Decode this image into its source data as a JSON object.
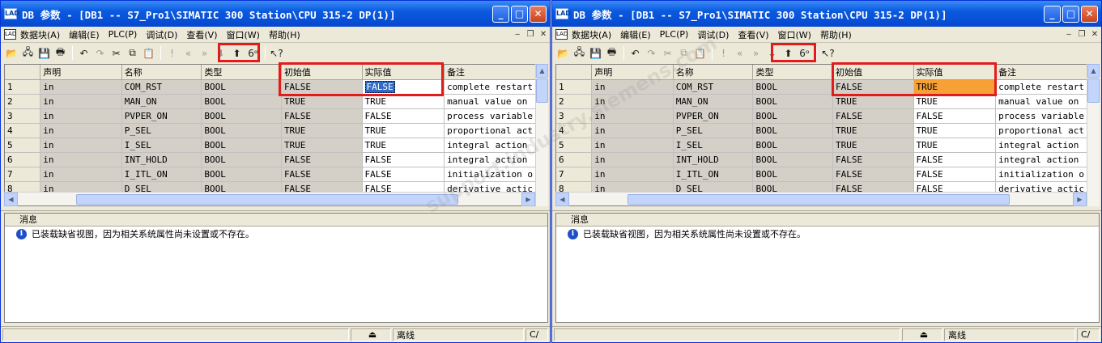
{
  "accent_color": "#e21b1b",
  "windows": [
    {
      "id": "left",
      "title": "DB 参数 - [DB1 -- S7_Pro1\\SIMATIC 300 Station\\CPU 315-2 DP(1)]",
      "menu": [
        "数据块(A)",
        "编辑(E)",
        "PLC(P)",
        "调试(D)",
        "查看(V)",
        "窗口(W)",
        "帮助(H)"
      ],
      "columns": [
        "",
        "声明",
        "名称",
        "类型",
        "初始值",
        "实际值",
        "备注"
      ],
      "rows": [
        {
          "num": "1",
          "decl": "in",
          "name": "COM_RST",
          "type": "BOOL",
          "initial": "FALSE",
          "actual": "FALSE",
          "comment": "complete restart"
        },
        {
          "num": "2",
          "decl": "in",
          "name": "MAN_ON",
          "type": "BOOL",
          "initial": "TRUE",
          "actual": "TRUE",
          "comment": "manual value on"
        },
        {
          "num": "3",
          "decl": "in",
          "name": "PVPER_ON",
          "type": "BOOL",
          "initial": "FALSE",
          "actual": "FALSE",
          "comment": "process variable"
        },
        {
          "num": "4",
          "decl": "in",
          "name": "P_SEL",
          "type": "BOOL",
          "initial": "TRUE",
          "actual": "TRUE",
          "comment": "proportional act"
        },
        {
          "num": "5",
          "decl": "in",
          "name": "I_SEL",
          "type": "BOOL",
          "initial": "TRUE",
          "actual": "TRUE",
          "comment": "integral action"
        },
        {
          "num": "6",
          "decl": "in",
          "name": "INT_HOLD",
          "type": "BOOL",
          "initial": "FALSE",
          "actual": "FALSE",
          "comment": "integral action"
        },
        {
          "num": "7",
          "decl": "in",
          "name": "I_ITL_ON",
          "type": "BOOL",
          "initial": "FALSE",
          "actual": "FALSE",
          "comment": "initialization o"
        },
        {
          "num": "8",
          "decl": "in",
          "name": "D_SEL",
          "type": "BOOL",
          "initial": "FALSE",
          "actual": "FALSE",
          "comment": "derivative actic"
        }
      ],
      "messages_header": "消息",
      "message": "已装载缺省视图，因为相关系统属性尚未设置或不存在。",
      "status_mode": "离线",
      "status_ci": "C/"
    },
    {
      "id": "right",
      "title": "DB 参数 - [DB1 -- S7_Pro1\\SIMATIC 300 Station\\CPU 315-2 DP(1)]",
      "menu": [
        "数据块(A)",
        "编辑(E)",
        "PLC(P)",
        "调试(D)",
        "查看(V)",
        "窗口(W)",
        "帮助(H)"
      ],
      "columns": [
        "",
        "声明",
        "名称",
        "类型",
        "初始值",
        "实际值",
        "备注"
      ],
      "rows": [
        {
          "num": "1",
          "decl": "in",
          "name": "COM_RST",
          "type": "BOOL",
          "initial": "FALSE",
          "actual": "TRUE",
          "comment": "complete restart"
        },
        {
          "num": "2",
          "decl": "in",
          "name": "MAN_ON",
          "type": "BOOL",
          "initial": "TRUE",
          "actual": "TRUE",
          "comment": "manual value on"
        },
        {
          "num": "3",
          "decl": "in",
          "name": "PVPER_ON",
          "type": "BOOL",
          "initial": "FALSE",
          "actual": "FALSE",
          "comment": "process variable"
        },
        {
          "num": "4",
          "decl": "in",
          "name": "P_SEL",
          "type": "BOOL",
          "initial": "TRUE",
          "actual": "TRUE",
          "comment": "proportional act"
        },
        {
          "num": "5",
          "decl": "in",
          "name": "I_SEL",
          "type": "BOOL",
          "initial": "TRUE",
          "actual": "TRUE",
          "comment": "integral action"
        },
        {
          "num": "6",
          "decl": "in",
          "name": "INT_HOLD",
          "type": "BOOL",
          "initial": "FALSE",
          "actual": "FALSE",
          "comment": "integral action"
        },
        {
          "num": "7",
          "decl": "in",
          "name": "I_ITL_ON",
          "type": "BOOL",
          "initial": "FALSE",
          "actual": "FALSE",
          "comment": "initialization o"
        },
        {
          "num": "8",
          "decl": "in",
          "name": "D_SEL",
          "type": "BOOL",
          "initial": "FALSE",
          "actual": "FALSE",
          "comment": "derivative actic"
        }
      ],
      "messages_header": "消息",
      "message": "已装载缺省视图，因为相关系统属性尚未设置或不存在。",
      "status_mode": "离线",
      "status_ci": "C/"
    }
  ],
  "watermark": "support.industry.siemens.com"
}
